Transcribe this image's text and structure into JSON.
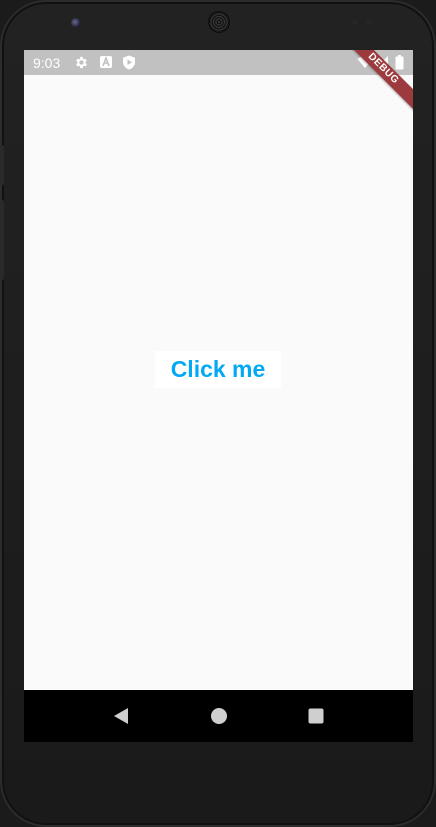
{
  "status_bar": {
    "time": "9:03",
    "icons": [
      "gear-icon",
      "a-icon",
      "shield-play-icon"
    ],
    "right_icons": [
      "wifi-icon",
      "signal-icon",
      "battery-icon"
    ]
  },
  "debug_banner": {
    "label": "DEBUG",
    "color": "#9c3a3e"
  },
  "main": {
    "button_label": "Click me",
    "accent_color": "#03a9f4"
  },
  "nav_bar": {
    "buttons": [
      "back-icon",
      "home-icon",
      "recents-icon"
    ]
  }
}
